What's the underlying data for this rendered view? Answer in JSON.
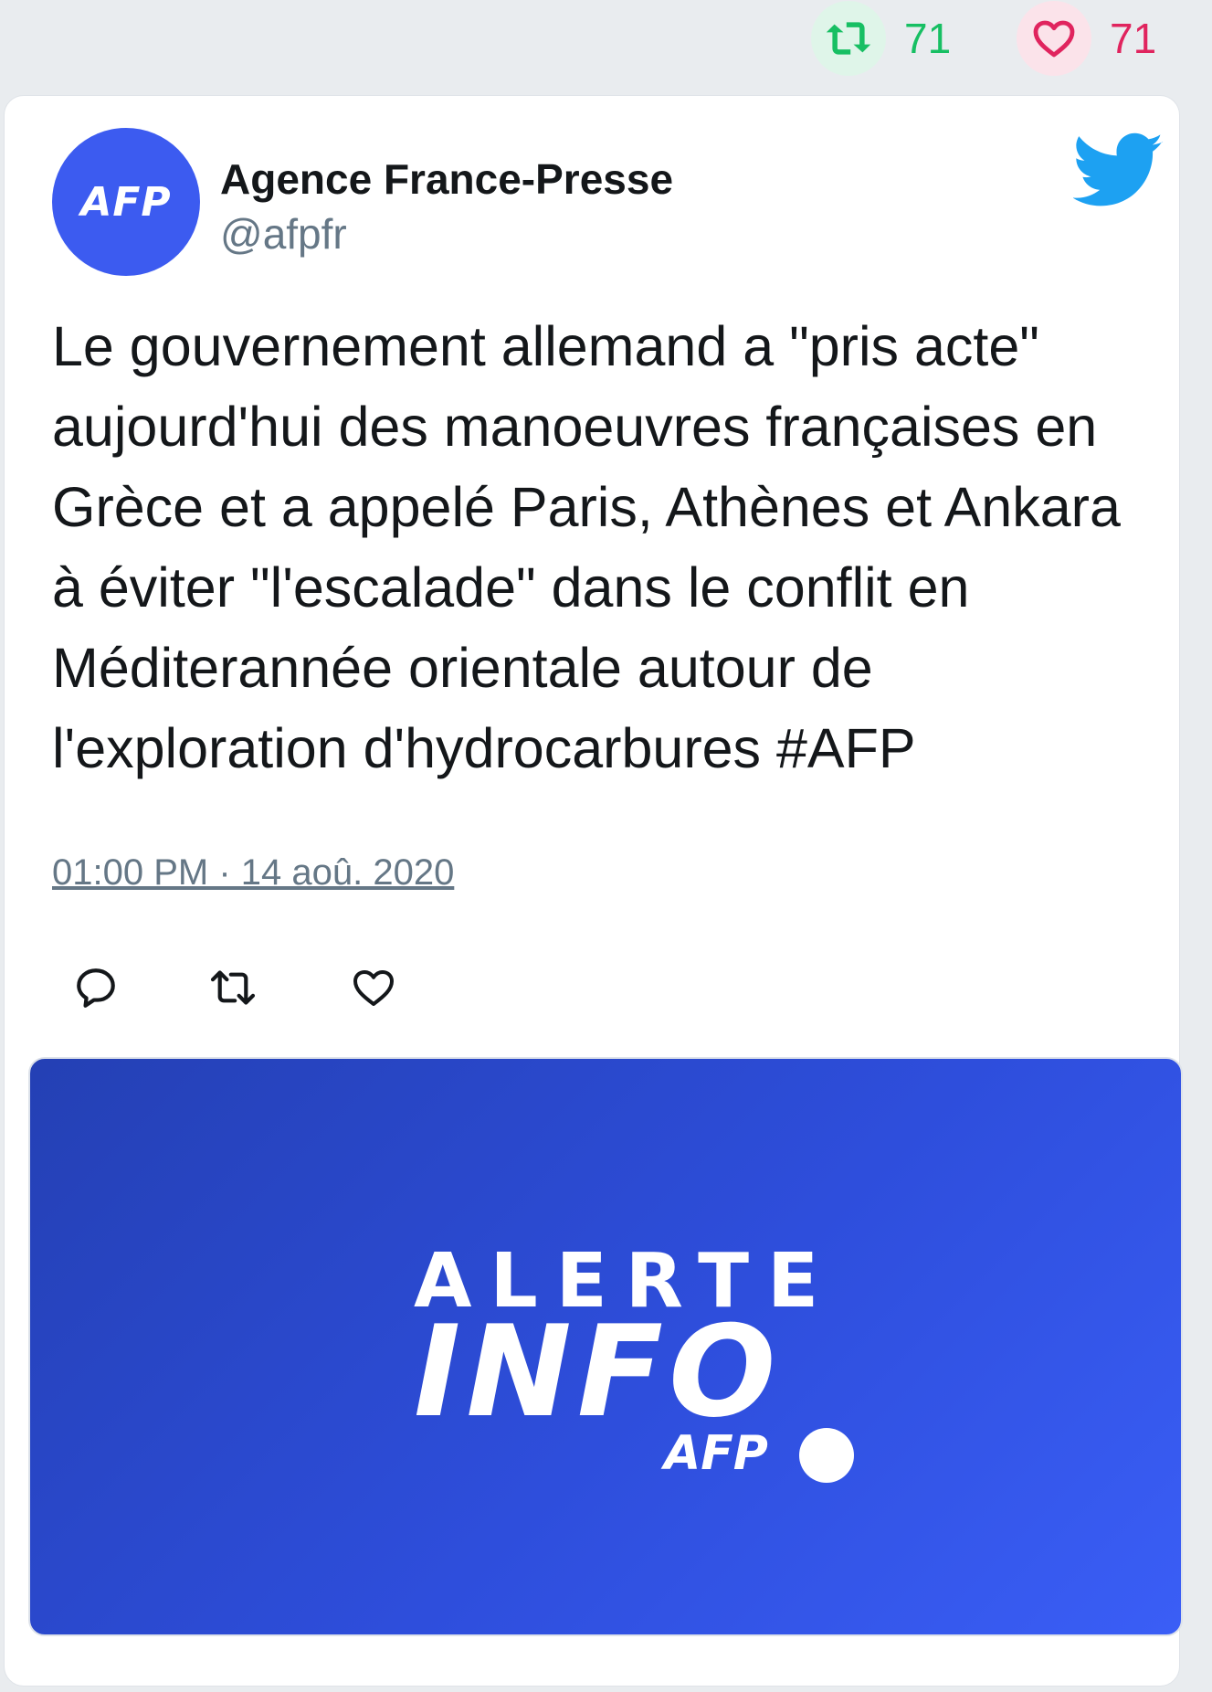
{
  "stats": {
    "retweets": "71",
    "likes": "71"
  },
  "author": {
    "avatar_text": "AFP",
    "name": "Agence France-Presse",
    "handle": "@afpfr"
  },
  "tweet": {
    "text": "Le gouvernement allemand a \"pris acte\" aujourd'hui des manoeuvres françaises en Grèce et a appelé Paris, Athènes et Ankara à éviter \"l'escalade\" dans le conflit en Méditerannée orientale autour de l'exploration d'hydrocarbures #AFP",
    "timestamp": "01:00 PM · 14 aoû. 2020"
  },
  "media": {
    "line1": "ALERTE",
    "line2": "INFO",
    "logo": "AFP"
  },
  "icons": {
    "retweet": "retweet-icon",
    "like": "heart-icon",
    "reply": "reply-icon",
    "brand": "twitter-bird-icon"
  },
  "colors": {
    "retweet": "#17bf63",
    "like": "#e0245e",
    "twitter": "#1da1f2",
    "avatar": "#3c5bf0"
  }
}
